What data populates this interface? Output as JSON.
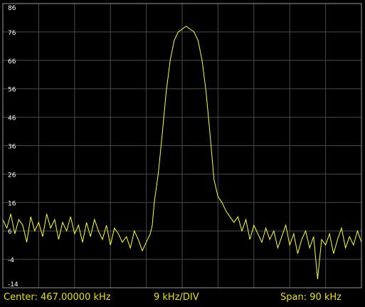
{
  "colors": {
    "background": "#000000",
    "grid": "#4a4a4a",
    "frame": "#9a9a9a",
    "trace": "#ffff30",
    "tick_text": "#ffffff",
    "status_text": "#e8e000"
  },
  "status": {
    "center": "Center: 467.00000 kHz",
    "per_div": "9 kHz/DIV",
    "span": "Span: 90 kHz"
  },
  "chart_data": {
    "type": "line",
    "title": "",
    "xlabel": "",
    "ylabel": "",
    "xlim": [
      422,
      512
    ],
    "ylim": [
      -14,
      86
    ],
    "x_unit": "kHz",
    "grid": true,
    "y_ticks": [
      86,
      76,
      66,
      56,
      46,
      36,
      26,
      16,
      6,
      -4,
      -14
    ],
    "series": [
      {
        "x": [
          422.0,
          423.0,
          424.0,
          425.0,
          426.0,
          427.0,
          428.0,
          429.0,
          430.0,
          431.0,
          432.0,
          433.0,
          434.0,
          435.0,
          436.0,
          437.0,
          438.0,
          439.0,
          440.0,
          441.0,
          442.0,
          443.0,
          444.0,
          445.0,
          446.0,
          447.0,
          448.0,
          449.0,
          450.0,
          451.0,
          452.0,
          453.0,
          454.0,
          455.0,
          456.0,
          457.0,
          458.0,
          459.0,
          459.5,
          460.0,
          461.0,
          462.0,
          463.0,
          464.0,
          465.0,
          466.0,
          467.0,
          468.0,
          469.0,
          470.0,
          471.0,
          472.0,
          473.0,
          474.0,
          474.5,
          475.0,
          476.0,
          477.0,
          478.0,
          479.0,
          480.0,
          481.0,
          482.0,
          483.0,
          484.0,
          485.0,
          486.0,
          487.0,
          488.0,
          489.0,
          490.0,
          491.0,
          492.0,
          493.0,
          494.0,
          495.0,
          496.0,
          497.0,
          498.0,
          499.0,
          500.0,
          501.0,
          502.0,
          503.0,
          504.0,
          505.0,
          506.0,
          507.0,
          508.0,
          509.0,
          510.0,
          511.0,
          512.0
        ],
        "values": [
          10,
          7,
          12,
          5,
          10,
          8,
          2,
          11,
          6,
          9,
          4,
          12,
          7,
          10,
          3,
          9,
          6,
          11,
          5,
          8,
          2,
          9,
          4,
          10,
          6,
          3,
          8,
          1,
          7,
          5,
          2,
          4,
          0,
          6,
          3,
          -1,
          2,
          5,
          8,
          16,
          26,
          40,
          55,
          66,
          73,
          76,
          77,
          78,
          77,
          76,
          73,
          66,
          55,
          40,
          32,
          24,
          18,
          16,
          13,
          11,
          9,
          11,
          6,
          10,
          3,
          8,
          5,
          2,
          7,
          3,
          6,
          0,
          4,
          8,
          1,
          5,
          -2,
          3,
          6,
          0,
          4,
          -11,
          3,
          1,
          5,
          -2,
          3,
          7,
          0,
          4,
          1,
          6,
          2
        ]
      }
    ]
  }
}
